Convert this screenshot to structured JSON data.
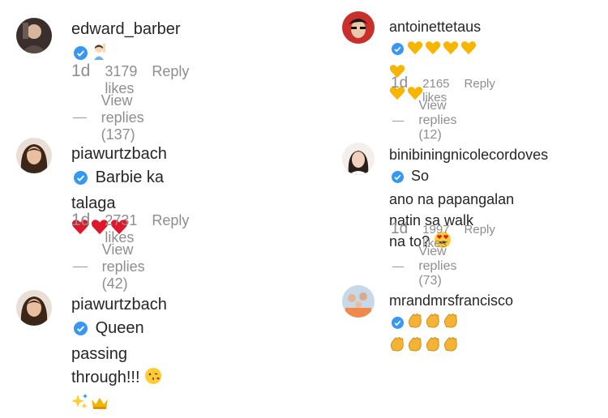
{
  "comments": [
    {
      "username": "edward_barber",
      "text": "",
      "verified": true,
      "emojis": [
        "raising-hand-emoji"
      ],
      "time": "1d",
      "likes": "3179 likes",
      "reply": "Reply",
      "replies": "View replies (137)"
    },
    {
      "username": "antoinettetaus",
      "text": "",
      "verified": true,
      "emojis": [
        "yellow-heart-emoji",
        "yellow-heart-emoji",
        "yellow-heart-emoji",
        "yellow-heart-emoji",
        "yellow-heart-emoji",
        "yellow-heart-emoji",
        "yellow-heart-emoji"
      ],
      "time": "1d",
      "likes": "2165 likes",
      "reply": "Reply",
      "replies": "View replies (12)"
    },
    {
      "username": "piawurtzbach",
      "text": "Barbie ka talaga",
      "verified": true,
      "emojis": [
        "red-heart-emoji",
        "red-heart-emoji",
        "red-heart-emoji"
      ],
      "time": "1d",
      "likes": "2731 likes",
      "reply": "Reply",
      "replies": "View replies (42)"
    },
    {
      "username": "binibiningnicolecordoves",
      "text_line1": "So",
      "text_line2": "ano na papangalan natin sa walk",
      "text_line3": "na to?",
      "verified": true,
      "emojis": [
        "heart-eyes-emoji"
      ],
      "time": "1d",
      "likes": "1997 likes",
      "reply": "Reply",
      "replies": "View replies (73)"
    },
    {
      "username": "piawurtzbach",
      "text_line1": "Queen passing",
      "text_line2": "through!!!",
      "verified": true,
      "emojis": [
        "kissing-face-emoji",
        "sparkles-emoji",
        "crown-emoji"
      ]
    },
    {
      "username": "mrandmrsfrancisco",
      "text": "",
      "verified": true,
      "emojis": [
        "clapping-hands-emoji",
        "clapping-hands-emoji",
        "clapping-hands-emoji",
        "clapping-hands-emoji",
        "clapping-hands-emoji",
        "clapping-hands-emoji",
        "clapping-hands-emoji"
      ]
    }
  ],
  "colors": {
    "verified_blue": "#3897f0",
    "meta_gray": "#8e8e8e",
    "yellow_heart": "#f7b500",
    "red_heart": "#e0162b"
  }
}
